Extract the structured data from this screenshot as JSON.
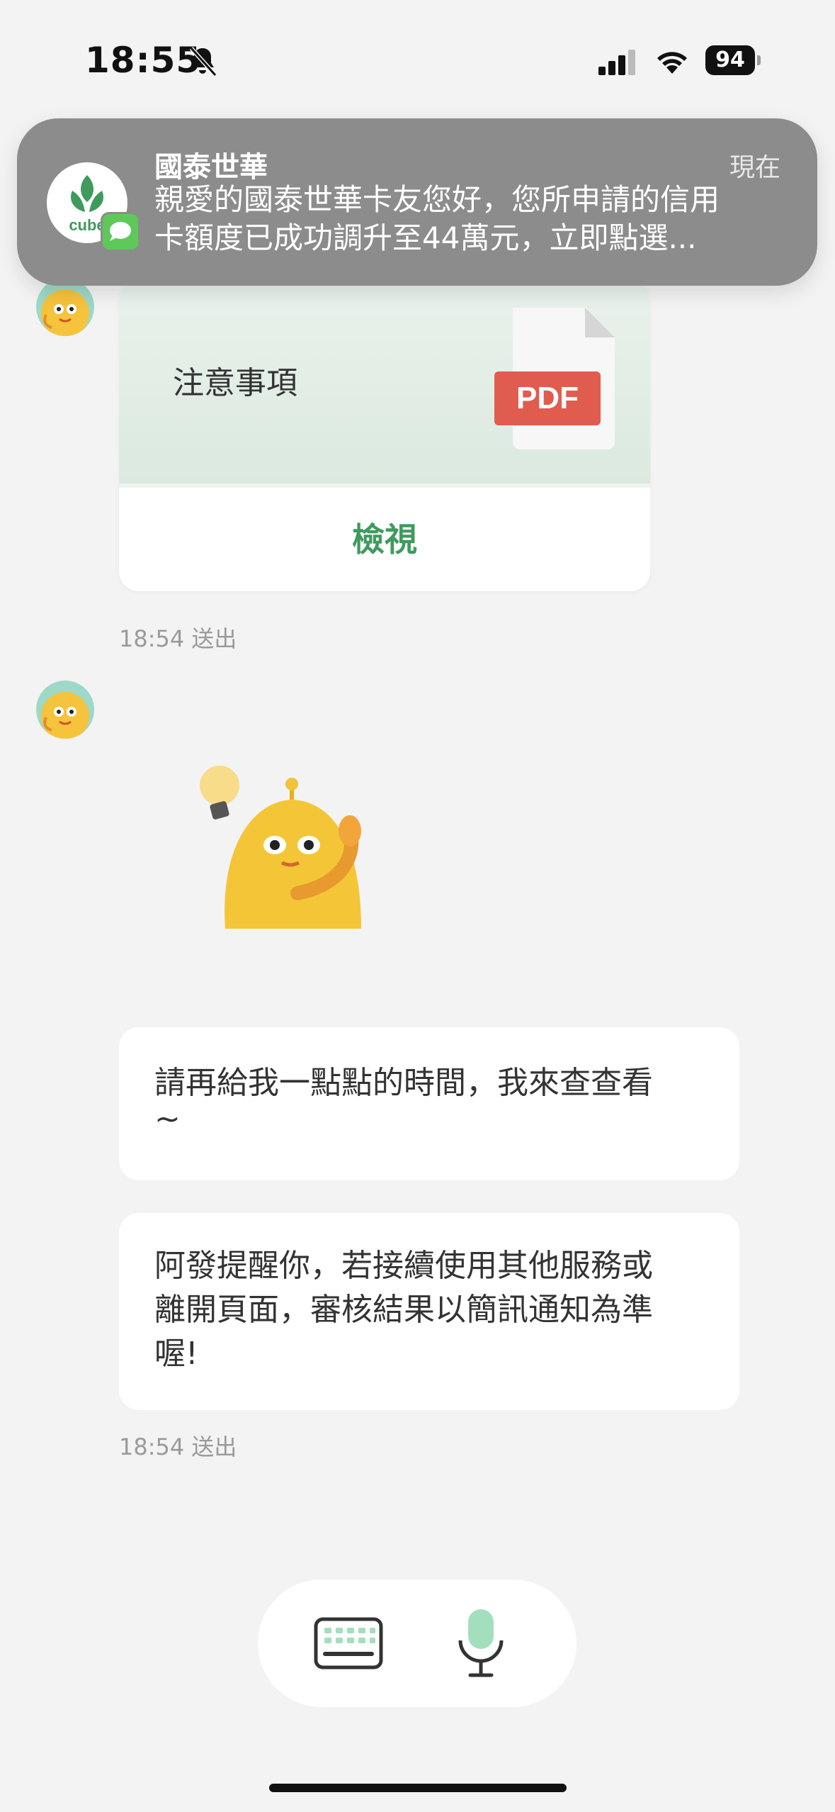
{
  "status_bar": {
    "time": "18:55",
    "silent_icon": "bell-slash-icon",
    "signal_icon": "cellular-signal-icon",
    "wifi_icon": "wifi-icon",
    "battery_level": "94"
  },
  "notification": {
    "app_name": "國泰世華",
    "time": "現在",
    "message_line1": "親愛的國泰世華卡友您好，您所申請的信用",
    "message_line2": "卡額度已成功調升至44萬元，立即點選...",
    "app_icon": "cube-app-icon",
    "app_icon_text": "cube",
    "badge_icon": "messages-icon",
    "accent_color": "#3f9a5e"
  },
  "pdf_card": {
    "title": "注意事項",
    "file_badge": "PDF",
    "view_label": "檢視",
    "timestamp": "18:54 送出"
  },
  "messages": [
    {
      "text_line1": "請再給我一點點的時間，我來查查看",
      "text_line2": "~"
    },
    {
      "text_line1": "阿發提醒你，若接續使用其他服務或",
      "text_line2": "離開頁面，審核結果以簡訊通知為準",
      "text_line3": "喔!"
    }
  ],
  "messages_timestamp": "18:54 送出",
  "input_bar": {
    "keyboard_icon": "keyboard-icon",
    "mic_icon": "microphone-icon"
  },
  "colors": {
    "background": "#f3f3f3",
    "brand_green": "#3f9a5e",
    "pdf_red": "#e05c4f",
    "mic_green": "#a3dfbd"
  }
}
